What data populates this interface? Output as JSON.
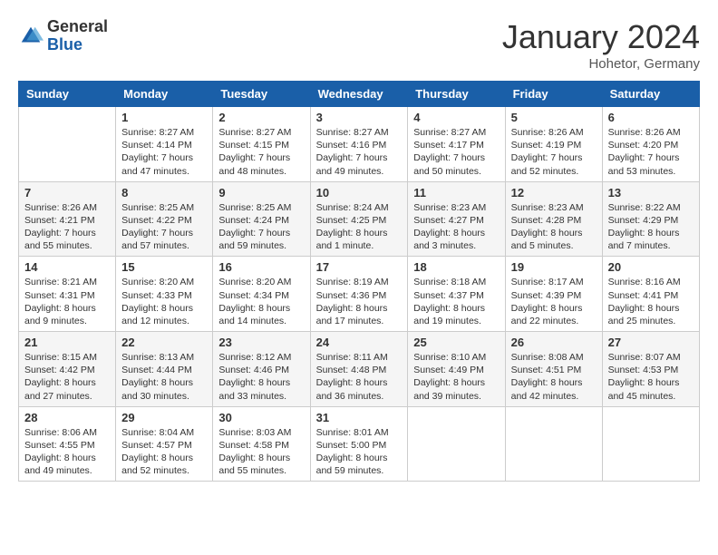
{
  "header": {
    "logo_general": "General",
    "logo_blue": "Blue",
    "month_title": "January 2024",
    "location": "Hohetor, Germany"
  },
  "columns": [
    "Sunday",
    "Monday",
    "Tuesday",
    "Wednesday",
    "Thursday",
    "Friday",
    "Saturday"
  ],
  "weeks": [
    [
      {
        "day": "",
        "info": ""
      },
      {
        "day": "1",
        "info": "Sunrise: 8:27 AM\nSunset: 4:14 PM\nDaylight: 7 hours\nand 47 minutes."
      },
      {
        "day": "2",
        "info": "Sunrise: 8:27 AM\nSunset: 4:15 PM\nDaylight: 7 hours\nand 48 minutes."
      },
      {
        "day": "3",
        "info": "Sunrise: 8:27 AM\nSunset: 4:16 PM\nDaylight: 7 hours\nand 49 minutes."
      },
      {
        "day": "4",
        "info": "Sunrise: 8:27 AM\nSunset: 4:17 PM\nDaylight: 7 hours\nand 50 minutes."
      },
      {
        "day": "5",
        "info": "Sunrise: 8:26 AM\nSunset: 4:19 PM\nDaylight: 7 hours\nand 52 minutes."
      },
      {
        "day": "6",
        "info": "Sunrise: 8:26 AM\nSunset: 4:20 PM\nDaylight: 7 hours\nand 53 minutes."
      }
    ],
    [
      {
        "day": "7",
        "info": "Sunrise: 8:26 AM\nSunset: 4:21 PM\nDaylight: 7 hours\nand 55 minutes."
      },
      {
        "day": "8",
        "info": "Sunrise: 8:25 AM\nSunset: 4:22 PM\nDaylight: 7 hours\nand 57 minutes."
      },
      {
        "day": "9",
        "info": "Sunrise: 8:25 AM\nSunset: 4:24 PM\nDaylight: 7 hours\nand 59 minutes."
      },
      {
        "day": "10",
        "info": "Sunrise: 8:24 AM\nSunset: 4:25 PM\nDaylight: 8 hours\nand 1 minute."
      },
      {
        "day": "11",
        "info": "Sunrise: 8:23 AM\nSunset: 4:27 PM\nDaylight: 8 hours\nand 3 minutes."
      },
      {
        "day": "12",
        "info": "Sunrise: 8:23 AM\nSunset: 4:28 PM\nDaylight: 8 hours\nand 5 minutes."
      },
      {
        "day": "13",
        "info": "Sunrise: 8:22 AM\nSunset: 4:29 PM\nDaylight: 8 hours\nand 7 minutes."
      }
    ],
    [
      {
        "day": "14",
        "info": "Sunrise: 8:21 AM\nSunset: 4:31 PM\nDaylight: 8 hours\nand 9 minutes."
      },
      {
        "day": "15",
        "info": "Sunrise: 8:20 AM\nSunset: 4:33 PM\nDaylight: 8 hours\nand 12 minutes."
      },
      {
        "day": "16",
        "info": "Sunrise: 8:20 AM\nSunset: 4:34 PM\nDaylight: 8 hours\nand 14 minutes."
      },
      {
        "day": "17",
        "info": "Sunrise: 8:19 AM\nSunset: 4:36 PM\nDaylight: 8 hours\nand 17 minutes."
      },
      {
        "day": "18",
        "info": "Sunrise: 8:18 AM\nSunset: 4:37 PM\nDaylight: 8 hours\nand 19 minutes."
      },
      {
        "day": "19",
        "info": "Sunrise: 8:17 AM\nSunset: 4:39 PM\nDaylight: 8 hours\nand 22 minutes."
      },
      {
        "day": "20",
        "info": "Sunrise: 8:16 AM\nSunset: 4:41 PM\nDaylight: 8 hours\nand 25 minutes."
      }
    ],
    [
      {
        "day": "21",
        "info": "Sunrise: 8:15 AM\nSunset: 4:42 PM\nDaylight: 8 hours\nand 27 minutes."
      },
      {
        "day": "22",
        "info": "Sunrise: 8:13 AM\nSunset: 4:44 PM\nDaylight: 8 hours\nand 30 minutes."
      },
      {
        "day": "23",
        "info": "Sunrise: 8:12 AM\nSunset: 4:46 PM\nDaylight: 8 hours\nand 33 minutes."
      },
      {
        "day": "24",
        "info": "Sunrise: 8:11 AM\nSunset: 4:48 PM\nDaylight: 8 hours\nand 36 minutes."
      },
      {
        "day": "25",
        "info": "Sunrise: 8:10 AM\nSunset: 4:49 PM\nDaylight: 8 hours\nand 39 minutes."
      },
      {
        "day": "26",
        "info": "Sunrise: 8:08 AM\nSunset: 4:51 PM\nDaylight: 8 hours\nand 42 minutes."
      },
      {
        "day": "27",
        "info": "Sunrise: 8:07 AM\nSunset: 4:53 PM\nDaylight: 8 hours\nand 45 minutes."
      }
    ],
    [
      {
        "day": "28",
        "info": "Sunrise: 8:06 AM\nSunset: 4:55 PM\nDaylight: 8 hours\nand 49 minutes."
      },
      {
        "day": "29",
        "info": "Sunrise: 8:04 AM\nSunset: 4:57 PM\nDaylight: 8 hours\nand 52 minutes."
      },
      {
        "day": "30",
        "info": "Sunrise: 8:03 AM\nSunset: 4:58 PM\nDaylight: 8 hours\nand 55 minutes."
      },
      {
        "day": "31",
        "info": "Sunrise: 8:01 AM\nSunset: 5:00 PM\nDaylight: 8 hours\nand 59 minutes."
      },
      {
        "day": "",
        "info": ""
      },
      {
        "day": "",
        "info": ""
      },
      {
        "day": "",
        "info": ""
      }
    ]
  ]
}
